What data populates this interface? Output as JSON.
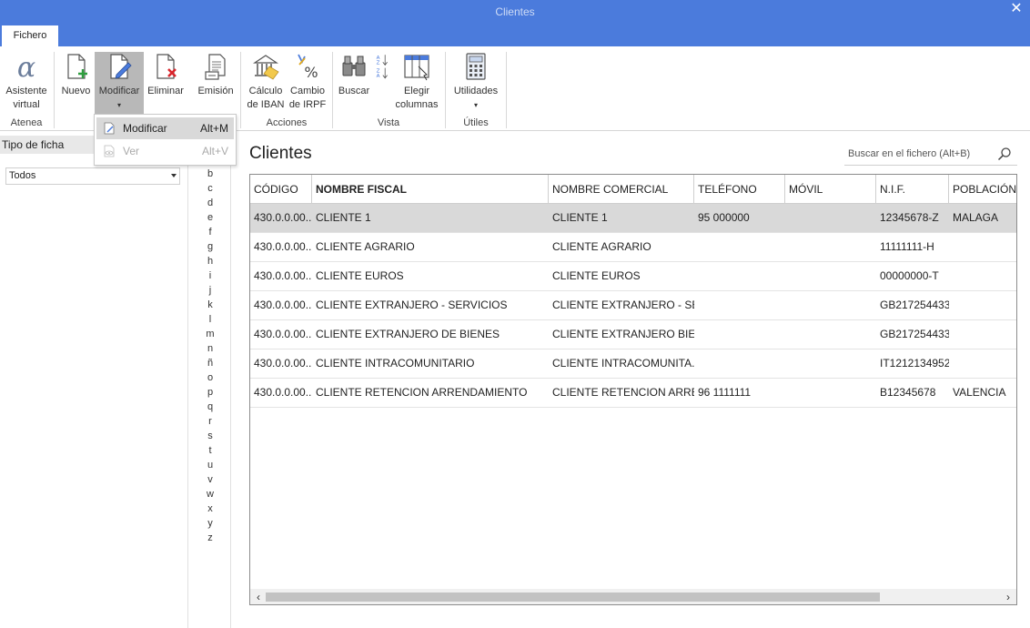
{
  "window": {
    "title": "Clientes",
    "close_glyph": "✕"
  },
  "tabs": [
    {
      "label": "Fichero"
    }
  ],
  "ribbon": {
    "buttons": {
      "asistente": {
        "line1": "Asistente",
        "line2": "virtual",
        "icon": "alpha-icon"
      },
      "nuevo": {
        "line1": "Nuevo",
        "icon": "new-document-icon"
      },
      "modificar": {
        "line1": "Modificar",
        "icon": "edit-document-icon"
      },
      "eliminar": {
        "line1": "Eliminar",
        "icon": "delete-document-icon"
      },
      "emision": {
        "line1": "Emisión",
        "icon": "print-document-icon"
      },
      "iban": {
        "line1": "Cálculo",
        "line2": "de IBAN",
        "icon": "bank-icon"
      },
      "irpf": {
        "line1": "Cambio",
        "line2": "de IRPF",
        "icon": "percent-icon"
      },
      "buscar": {
        "line1": "Buscar",
        "icon": "binoculars-icon"
      },
      "sort": {
        "icon": "sort-az-icon"
      },
      "columnas": {
        "line1": "Elegir",
        "line2": "columnas",
        "icon": "columns-icon"
      },
      "utilidades": {
        "line1": "Utilidades",
        "icon": "calculator-icon"
      }
    },
    "groups": {
      "atenea": "Atenea",
      "acciones": "Acciones",
      "vista": "Vista",
      "utiles": "Útiles"
    }
  },
  "dropdown": {
    "items": [
      {
        "label": "Modificar",
        "shortcut": "Alt+M",
        "enabled": true,
        "highlighted": true
      },
      {
        "label": "Ver",
        "shortcut": "Alt+V",
        "enabled": false
      }
    ]
  },
  "filter": {
    "header": "Tipo de ficha",
    "selected": "Todos"
  },
  "alphabet": [
    "b",
    "c",
    "d",
    "e",
    "f",
    "g",
    "h",
    "i",
    "j",
    "k",
    "l",
    "m",
    "n",
    "ñ",
    "o",
    "p",
    "q",
    "r",
    "s",
    "t",
    "u",
    "v",
    "w",
    "x",
    "y",
    "z"
  ],
  "main": {
    "title": "Clientes",
    "search_placeholder": "Buscar en el fichero (Alt+B)"
  },
  "table": {
    "columns": [
      "CÓDIGO",
      "NOMBRE FISCAL",
      "NOMBRE COMERCIAL",
      "TELÉFONO",
      "MÓVIL",
      "N.I.F.",
      "POBLACIÓN"
    ],
    "rows": [
      [
        "430.0.0.00...",
        "CLIENTE 1",
        "CLIENTE 1",
        "95 000000",
        "",
        "12345678-Z",
        "MALAGA"
      ],
      [
        "430.0.0.00...",
        "CLIENTE AGRARIO",
        "CLIENTE AGRARIO",
        "",
        "",
        "11111111-H",
        ""
      ],
      [
        "430.0.0.00...",
        "CLIENTE EUROS",
        "CLIENTE EUROS",
        "",
        "",
        "00000000-T",
        ""
      ],
      [
        "430.0.0.00...",
        "CLIENTE EXTRANJERO - SERVICIOS",
        "CLIENTE EXTRANJERO - SE...",
        "",
        "",
        "GB217254433",
        ""
      ],
      [
        "430.0.0.00...",
        "CLIENTE EXTRANJERO DE BIENES",
        "CLIENTE EXTRANJERO BIE...",
        "",
        "",
        "GB217254433",
        ""
      ],
      [
        "430.0.0.00...",
        "CLIENTE INTRACOMUNITARIO",
        "CLIENTE INTRACOMUNITA...",
        "",
        "",
        "IT1212134952",
        ""
      ],
      [
        "430.0.0.00...",
        "CLIENTE RETENCION ARRENDAMIENTO",
        "CLIENTE RETENCION ARRE...",
        "96 1111111",
        "",
        "B12345678",
        "VALENCIA"
      ]
    ],
    "selected_row": 0
  },
  "colors": {
    "titlebar": "#4b7bdc",
    "selection": "#d9d9d9",
    "accent_green": "#2e9e3e",
    "accent_red": "#d9262c"
  }
}
